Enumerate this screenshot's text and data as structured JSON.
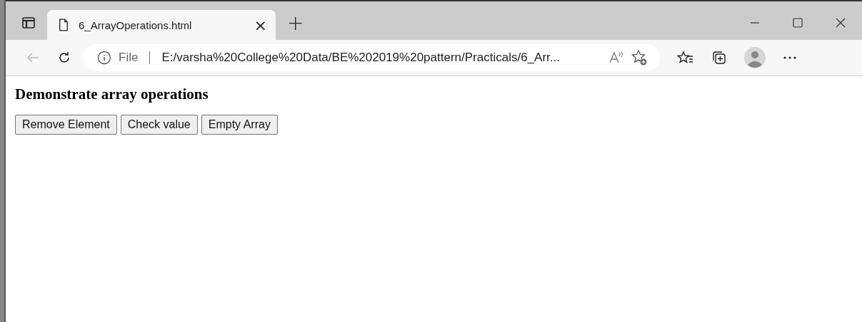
{
  "tab": {
    "title": "6_ArrayOperations.html",
    "selected": true
  },
  "tab_close": "×",
  "new_tab": "+",
  "address": {
    "scheme": "File",
    "url": "E:/varsha%20College%20Data/BE%202019%20pattern/Practicals/6_Arr..."
  },
  "page": {
    "heading": "Demonstrate array operations",
    "buttons": [
      "Remove Element",
      "Check value",
      "Empty Array"
    ]
  }
}
